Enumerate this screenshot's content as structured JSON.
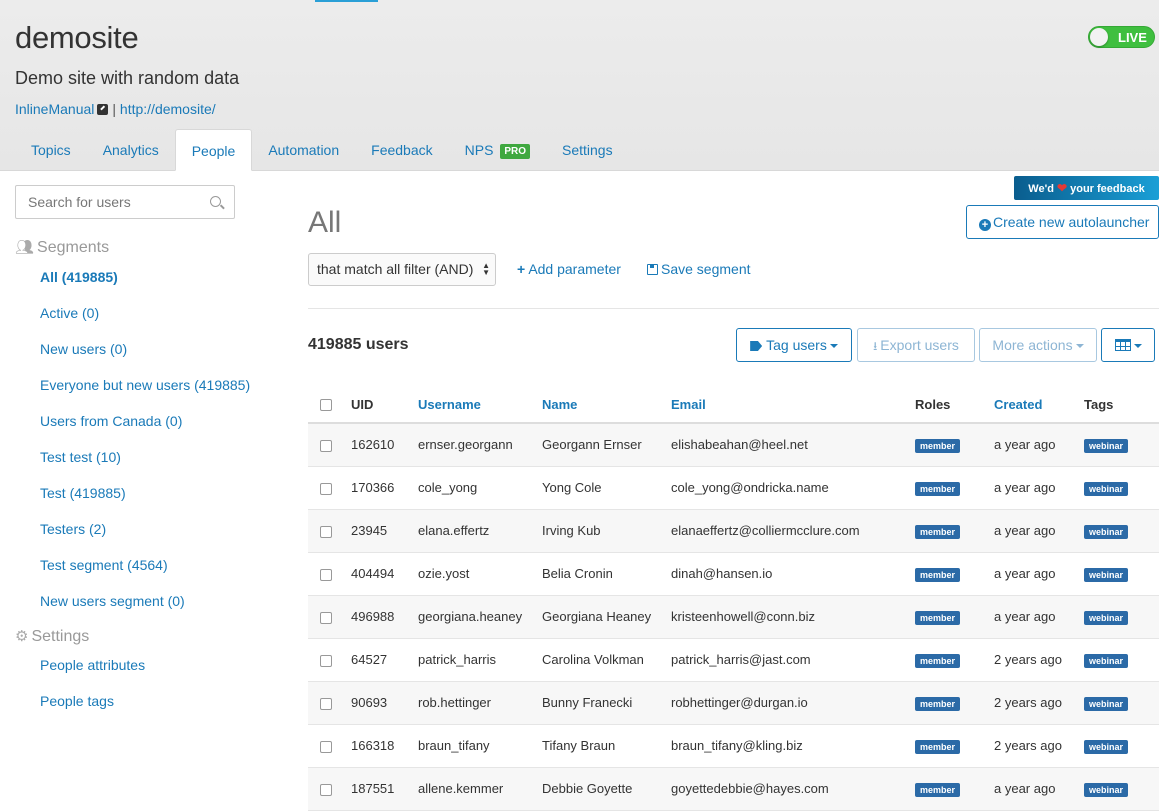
{
  "site": {
    "title": "demosite",
    "description": "Demo site with random data",
    "link_label": "InlineManual",
    "separator": "|",
    "url": "http://demosite/"
  },
  "live_toggle": {
    "label": "LIVE",
    "state": "on",
    "color": "#3fbf3f"
  },
  "tabs": [
    {
      "label": "Topics"
    },
    {
      "label": "Analytics"
    },
    {
      "label": "People",
      "active": true
    },
    {
      "label": "Automation"
    },
    {
      "label": "Feedback"
    },
    {
      "label": "NPS",
      "badge": "PRO"
    },
    {
      "label": "Settings"
    }
  ],
  "sidebar": {
    "search_placeholder": "Search for users",
    "segments_heading": "Segments",
    "segments": [
      {
        "label": "All (419885)",
        "active": true
      },
      {
        "label": "Active (0)"
      },
      {
        "label": "New users (0)"
      },
      {
        "label": "Everyone but new users (419885)"
      },
      {
        "label": "Users from Canada (0)"
      },
      {
        "label": "Test test (10)"
      },
      {
        "label": "Test (419885)"
      },
      {
        "label": "Testers (2)"
      },
      {
        "label": "Test segment (4564)"
      },
      {
        "label": "New users segment (0)"
      }
    ],
    "settings_heading": "Settings",
    "settings_items": [
      {
        "label": "People attributes"
      },
      {
        "label": "People tags"
      }
    ]
  },
  "feedback_badge": {
    "prefix": "We'd",
    "suffix": "your feedback",
    "icon": "heart-icon"
  },
  "main": {
    "title": "All",
    "create_button": "Create new autolauncher",
    "filter_select": "that match all filter (AND)",
    "add_parameter": "Add parameter",
    "save_segment": "Save segment",
    "user_count": "419885 users",
    "buttons": {
      "tag_users": "Tag users",
      "export_users": "Export users",
      "more_actions": "More actions"
    }
  },
  "table": {
    "columns": [
      "UID",
      "Username",
      "Name",
      "Email",
      "Roles",
      "Created",
      "Tags"
    ],
    "rows": [
      {
        "uid": "162610",
        "username": "ernser.georgann",
        "name": "Georgann Ernser",
        "email": "elishabeahan@heel.net",
        "role": "member",
        "created": "a year ago",
        "tag": "webinar"
      },
      {
        "uid": "170366",
        "username": "cole_yong",
        "name": "Yong Cole",
        "email": "cole_yong@ondricka.name",
        "role": "member",
        "created": "a year ago",
        "tag": "webinar"
      },
      {
        "uid": "23945",
        "username": "elana.effertz",
        "name": "Irving Kub",
        "email": "elanaeffertz@colliermcclure.com",
        "role": "member",
        "created": "a year ago",
        "tag": "webinar"
      },
      {
        "uid": "404494",
        "username": "ozie.yost",
        "name": "Belia Cronin",
        "email": "dinah@hansen.io",
        "role": "member",
        "created": "a year ago",
        "tag": "webinar"
      },
      {
        "uid": "496988",
        "username": "georgiana.heaney",
        "name": "Georgiana Heaney",
        "email": "kristeenhowell@conn.biz",
        "role": "member",
        "created": "a year ago",
        "tag": "webinar"
      },
      {
        "uid": "64527",
        "username": "patrick_harris",
        "name": "Carolina Volkman",
        "email": "patrick_harris@jast.com",
        "role": "member",
        "created": "2 years ago",
        "tag": "webinar"
      },
      {
        "uid": "90693",
        "username": "rob.hettinger",
        "name": "Bunny Franecki",
        "email": "robhettinger@durgan.io",
        "role": "member",
        "created": "2 years ago",
        "tag": "webinar"
      },
      {
        "uid": "166318",
        "username": "braun_tifany",
        "name": "Tifany Braun",
        "email": "braun_tifany@kling.biz",
        "role": "member",
        "created": "2 years ago",
        "tag": "webinar"
      },
      {
        "uid": "187551",
        "username": "allene.kemmer",
        "name": "Debbie Goyette",
        "email": "goyettedebbie@hayes.com",
        "role": "member",
        "created": "a year ago",
        "tag": "webinar"
      }
    ]
  },
  "colors": {
    "link": "#1a7ab8",
    "badge": "#2b6aa7",
    "live": "#3fbf3f",
    "pro": "#3fa83f"
  }
}
